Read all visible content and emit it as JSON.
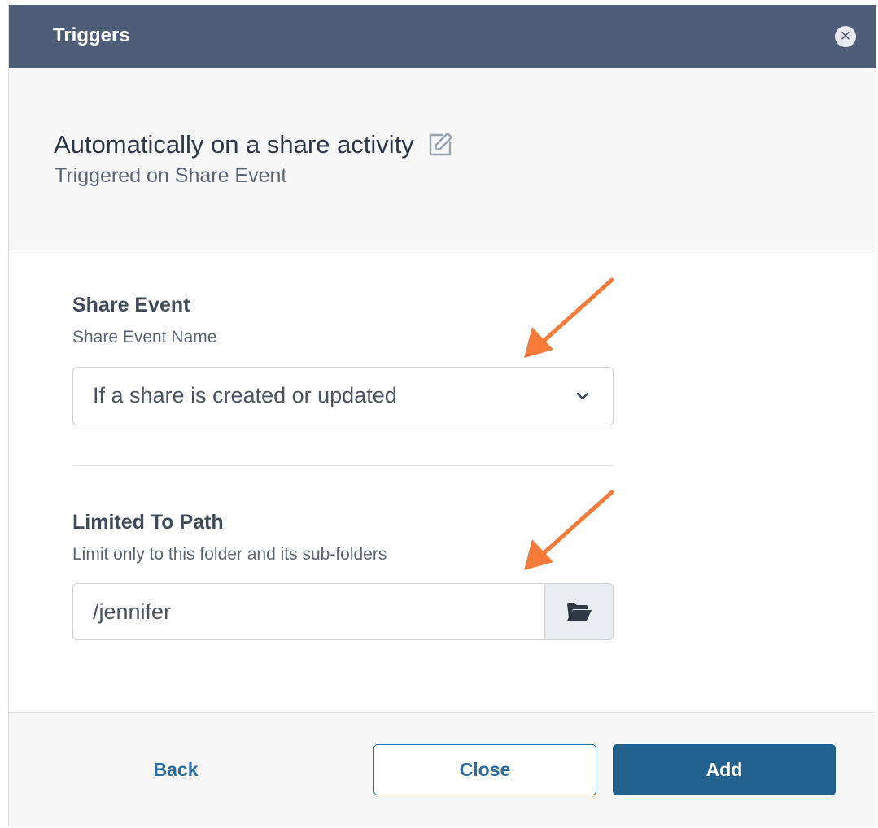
{
  "dialog": {
    "title": "Triggers",
    "close_icon": "close-circle-icon"
  },
  "summary": {
    "heading": "Automatically on a share activity",
    "edit_icon": "edit-icon",
    "subheading": "Triggered on Share Event"
  },
  "share_event": {
    "title": "Share Event",
    "description": "Share Event Name",
    "selected_value": "If a share is created or updated",
    "chevron_icon": "chevron-down-icon"
  },
  "limited_path": {
    "title": "Limited To Path",
    "description": "Limit only to this folder and its sub-folders",
    "value": "/jennifer",
    "folder_icon": "folder-open-icon"
  },
  "footer": {
    "back_label": "Back",
    "close_label": "Close",
    "add_label": "Add"
  },
  "colors": {
    "titlebar": "#4f5e78",
    "primary": "#23628f",
    "annotation_arrow": "#f47b3a"
  }
}
